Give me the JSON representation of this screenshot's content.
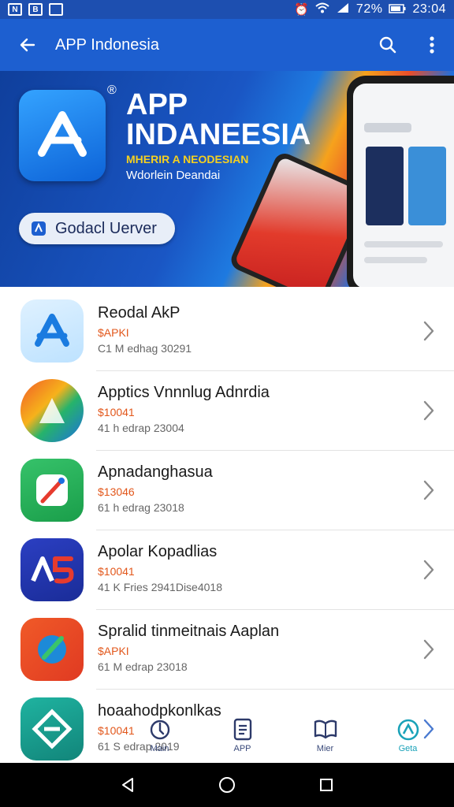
{
  "status_bar": {
    "left_icons": [
      "N",
      "B"
    ],
    "battery_percent": "72%",
    "time": "23:04"
  },
  "app_bar": {
    "title": "APP Indonesia"
  },
  "banner": {
    "title": "APP INDANEESIA",
    "subtitle": "MHERIR A NEODESIAN",
    "tagline": "Wdorlein Deandai",
    "button_label": "Godacl Uerver"
  },
  "apps": [
    {
      "name": "Reodal AkP",
      "price": "$APKI",
      "meta": "C1 M edhag 30291"
    },
    {
      "name": "Apptics Vnnnlug Adnrdia",
      "price": "$10041",
      "meta": "41 h edrap 23004"
    },
    {
      "name": "Apnadanghasua",
      "price": "$13046",
      "meta": "61 h edrag 23018"
    },
    {
      "name": "Apolar Kopadlias",
      "price": "$10041",
      "meta": "41 K Fries 2941Dise4018"
    },
    {
      "name": "Spralid tinmeitnais Aaplan",
      "price": "$APKI",
      "meta": "61 M edrap 23018"
    },
    {
      "name": "hoaahodpkonlkas",
      "price": "$10041",
      "meta": "61 S edrap 2019"
    }
  ],
  "bottom_nav": [
    {
      "label": "Main"
    },
    {
      "label": "APP"
    },
    {
      "label": "Mier"
    },
    {
      "label": "Geta"
    }
  ],
  "colors": {
    "app_bar": "#1d5fd0",
    "price": "#e2571b",
    "active_tab": "#1aa2b8"
  }
}
